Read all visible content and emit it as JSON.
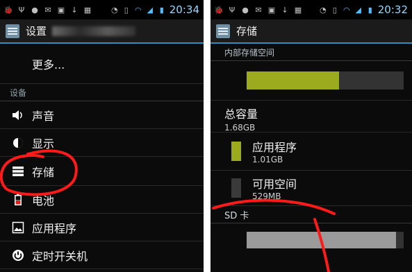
{
  "statusbar": {
    "time_left": "20:34",
    "time_right": "20:32"
  },
  "settings": {
    "title": "设置",
    "more": "更多...",
    "section_device": "设备",
    "items": [
      {
        "label": "声音",
        "icon": "volume-icon"
      },
      {
        "label": "显示",
        "icon": "brightness-icon"
      },
      {
        "label": "存储",
        "icon": "storage-icon"
      },
      {
        "label": "电池",
        "icon": "battery-icon"
      },
      {
        "label": "应用程序",
        "icon": "apps-icon"
      },
      {
        "label": "定时开关机",
        "icon": "power-icon"
      }
    ]
  },
  "storage": {
    "title": "存储",
    "internal_header": "内部存储空间",
    "internal_used_fraction": 0.59,
    "total_capacity_label": "总容量",
    "total_capacity_value": "1.68GB",
    "apps_label": "应用程序",
    "apps_value": "1.01GB",
    "available_label": "可用空间",
    "available_value": "529MB",
    "sd_header": "SD 卡",
    "sd_used_fraction": 0.95
  },
  "colors": {
    "accent": "#2e8ec6",
    "apps_bar": "#9cab1e",
    "sd_bar": "#9a9a9a",
    "annotation": "#ff1a1a"
  }
}
